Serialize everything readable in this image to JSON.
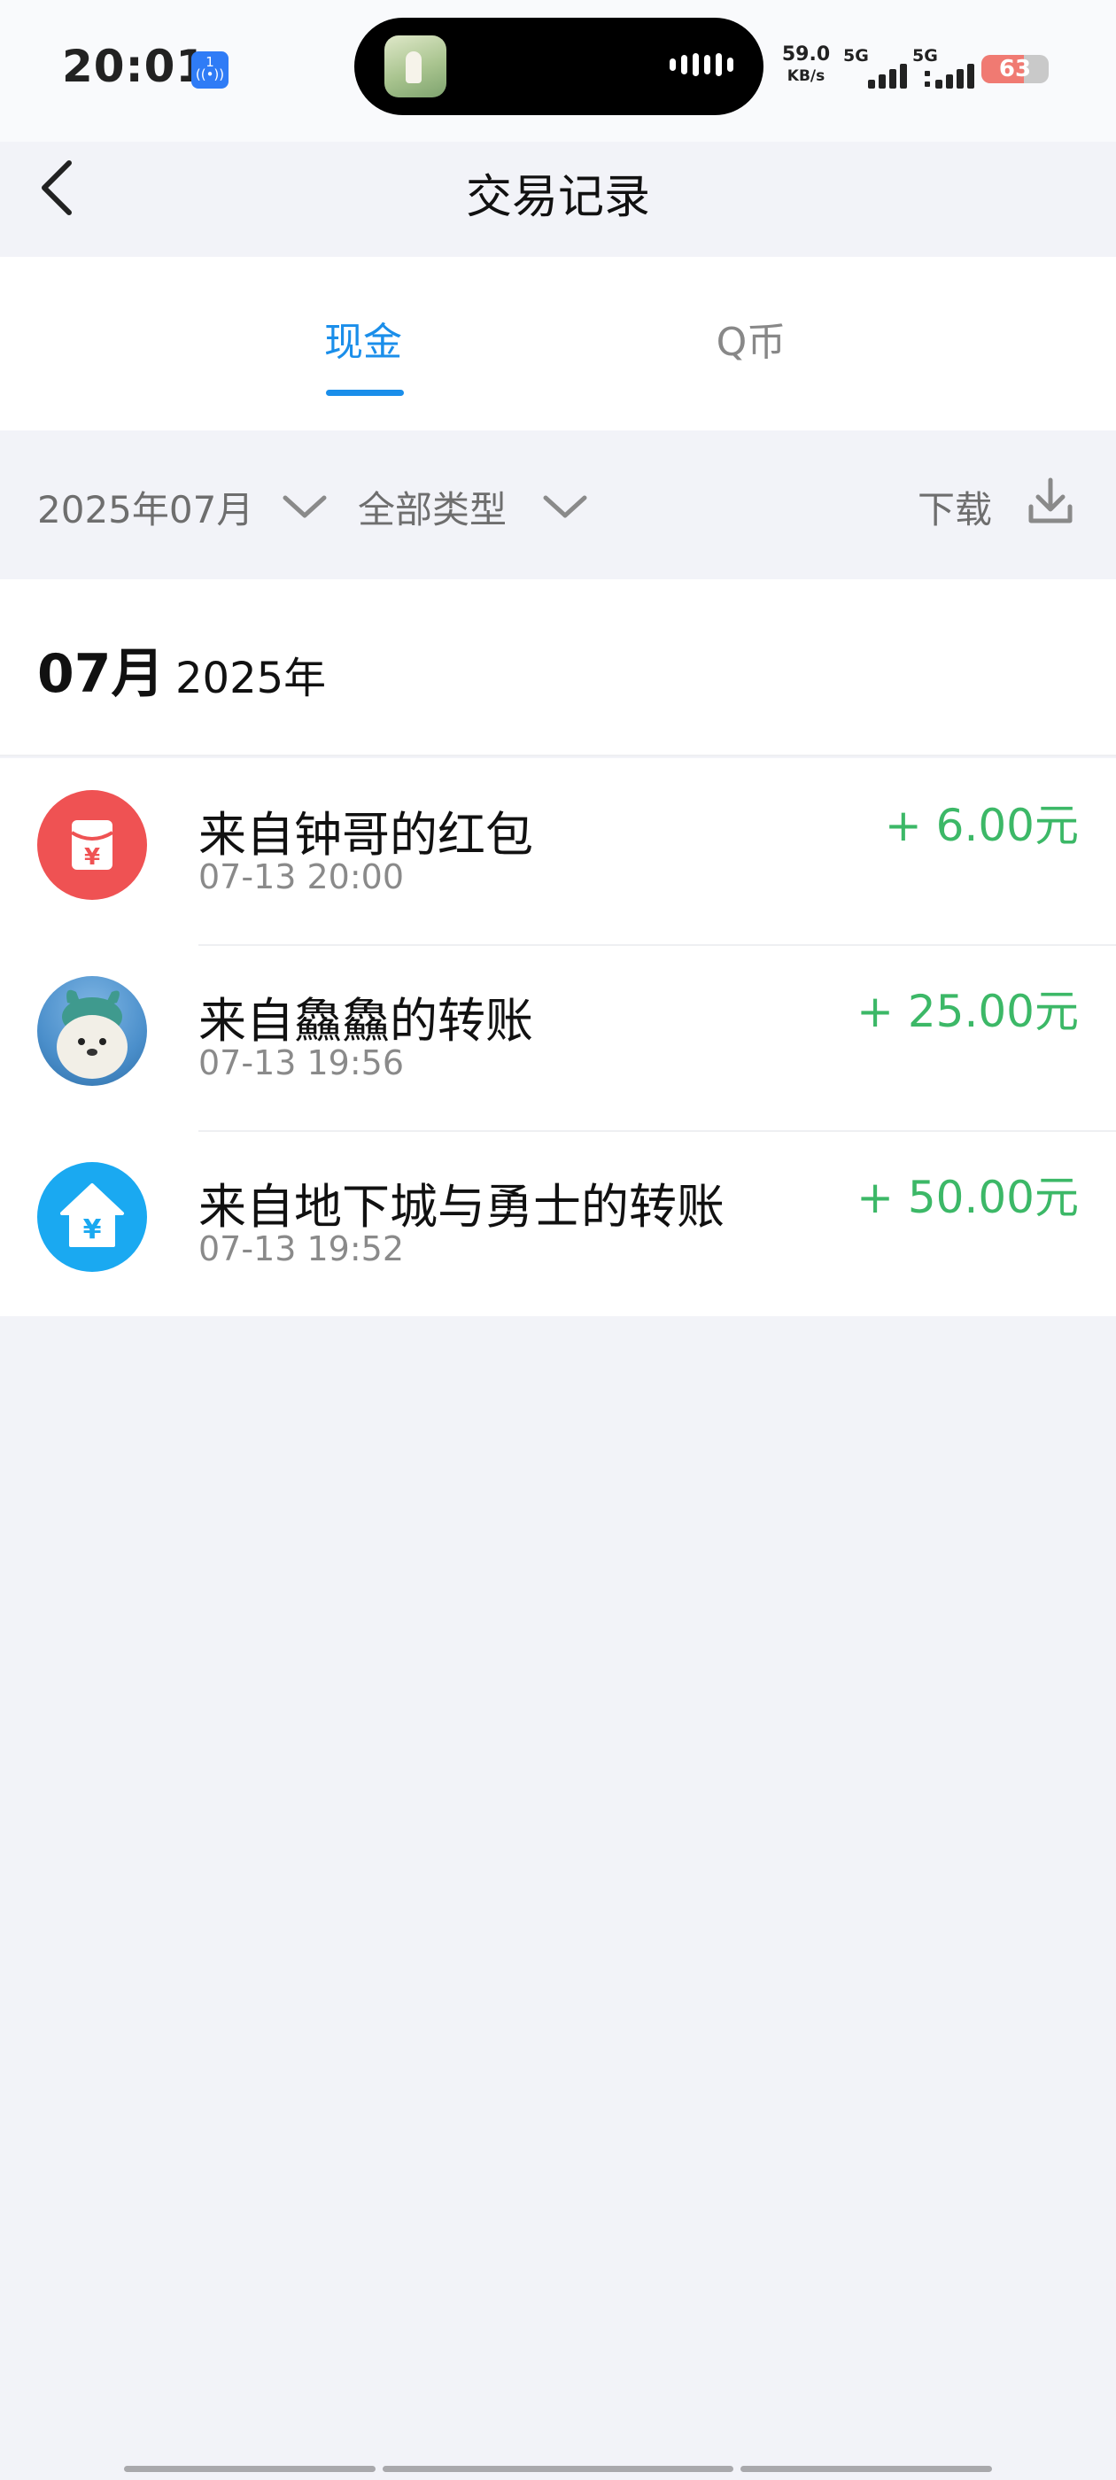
{
  "status_bar": {
    "time": "20:01",
    "nfc_badge_top": "1",
    "nfc_badge_icon": "((•))",
    "net_speed_value": "59.0",
    "net_speed_unit": "KB/s",
    "sim1_label": "5G",
    "sim2_label": "5G",
    "battery": "63",
    "battery_level": 0.63
  },
  "header": {
    "title": "交易记录",
    "back_icon": "chevron-left-icon"
  },
  "tabs": [
    {
      "label": "现金",
      "active": true
    },
    {
      "label": "Q币",
      "active": false
    }
  ],
  "filters": {
    "month": "2025年07月",
    "type": "全部类型",
    "download": "下载"
  },
  "list": {
    "month": "07月",
    "year": "2025年",
    "items": [
      {
        "title": "来自钟哥的红包",
        "time": "07-13 20:00",
        "amount": "+ 6.00元",
        "icon": "red-packet-icon"
      },
      {
        "title": "来自鱻鱻的转账",
        "time": "07-13 19:56",
        "amount": "+ 25.00元",
        "icon": "user-avatar"
      },
      {
        "title": "来自地下城与勇士的转账",
        "time": "07-13 19:52",
        "amount": "+ 50.00元",
        "icon": "yuan-house-icon"
      }
    ]
  },
  "colors": {
    "accent": "#1a8eea",
    "income": "#3cb867",
    "background": "#f2f3f8"
  }
}
